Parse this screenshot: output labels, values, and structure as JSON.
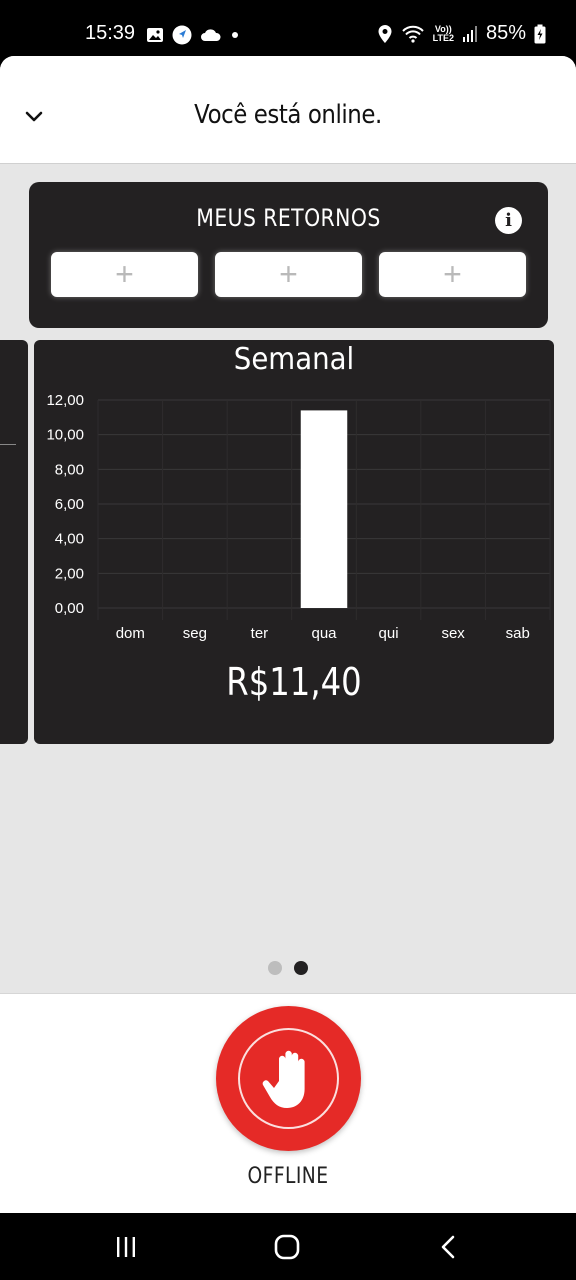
{
  "status_bar": {
    "time": "15:39",
    "network_label_top": "Vo))",
    "network_label_bottom": "LTE2",
    "battery": "85%"
  },
  "header": {
    "title": "Você está online."
  },
  "returns": {
    "title": "MEUS RETORNOS",
    "slots": [
      "+",
      "+",
      "+"
    ]
  },
  "chart_data": {
    "type": "bar",
    "title": "Semanal",
    "categories": [
      "dom",
      "seg",
      "ter",
      "qua",
      "qui",
      "sex",
      "sab"
    ],
    "values": [
      0,
      0,
      0,
      11.4,
      0,
      0,
      0
    ],
    "ylim": [
      0,
      12
    ],
    "yticks": [
      0,
      2,
      4,
      6,
      8,
      10,
      12
    ],
    "ytick_labels": [
      "0,00",
      "2,00",
      "4,00",
      "6,00",
      "8,00",
      "10,00",
      "12,00"
    ],
    "xlabel": "",
    "ylabel": "",
    "grid": true,
    "bar_color": "#ffffff",
    "background": "#232122"
  },
  "total": "R$11,40",
  "pager": {
    "count": 2,
    "active": 1
  },
  "offline_button": {
    "label": "OFFLINE",
    "color": "#e52a27"
  },
  "icons": {
    "collapse": "chevron-down-icon",
    "info": "info-icon",
    "offline": "hand-stop-icon",
    "nav_recents": "recents-icon",
    "nav_home": "home-icon",
    "nav_back": "back-icon"
  }
}
